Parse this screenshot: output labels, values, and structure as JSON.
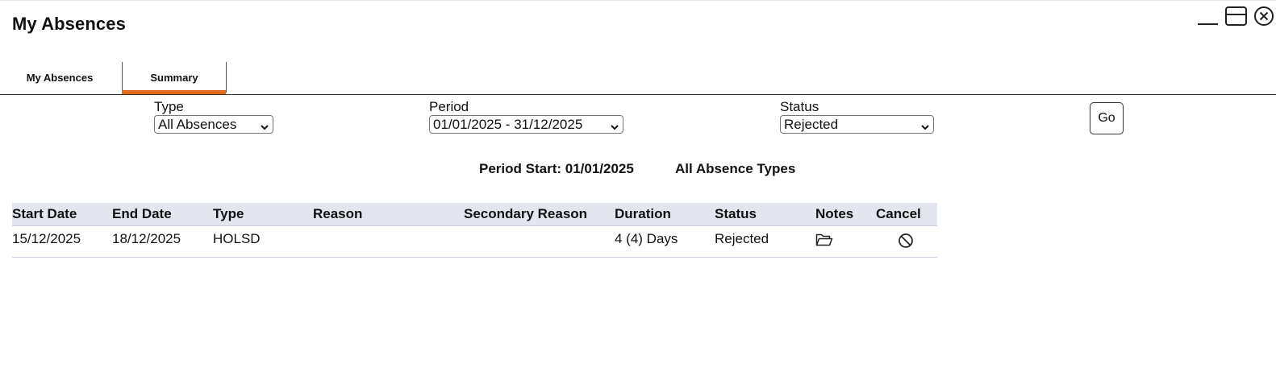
{
  "window": {
    "title": "My Absences",
    "controls": [
      "minimize-icon",
      "maximize-icon",
      "close-icon"
    ]
  },
  "tabs": [
    {
      "label": "My Absences",
      "active": false
    },
    {
      "label": "Summary",
      "active": true
    }
  ],
  "accent_color": "#e26a1c",
  "filters": {
    "type": {
      "label": "Type",
      "value": "All Absences"
    },
    "period": {
      "label": "Period",
      "value": "01/01/2025 - 31/12/2025"
    },
    "status": {
      "label": "Status",
      "value": "Rejected"
    },
    "go_label": "Go"
  },
  "summary": {
    "period_start": "Period Start: 01/01/2025",
    "absence_types": "All Absence Types"
  },
  "table": {
    "columns": [
      "Start Date",
      "End Date",
      "Type",
      "Reason",
      "Secondary Reason",
      "Duration",
      "Status",
      "Notes",
      "Cancel"
    ],
    "rows": [
      {
        "start_date": "15/12/2025",
        "end_date": "18/12/2025",
        "type": "HOLSD",
        "reason": "",
        "secondary_reason": "",
        "duration": "4 (4) Days",
        "status": "Rejected",
        "notes_icon": "folder-open-icon",
        "cancel_icon": "cancel-icon"
      }
    ]
  }
}
